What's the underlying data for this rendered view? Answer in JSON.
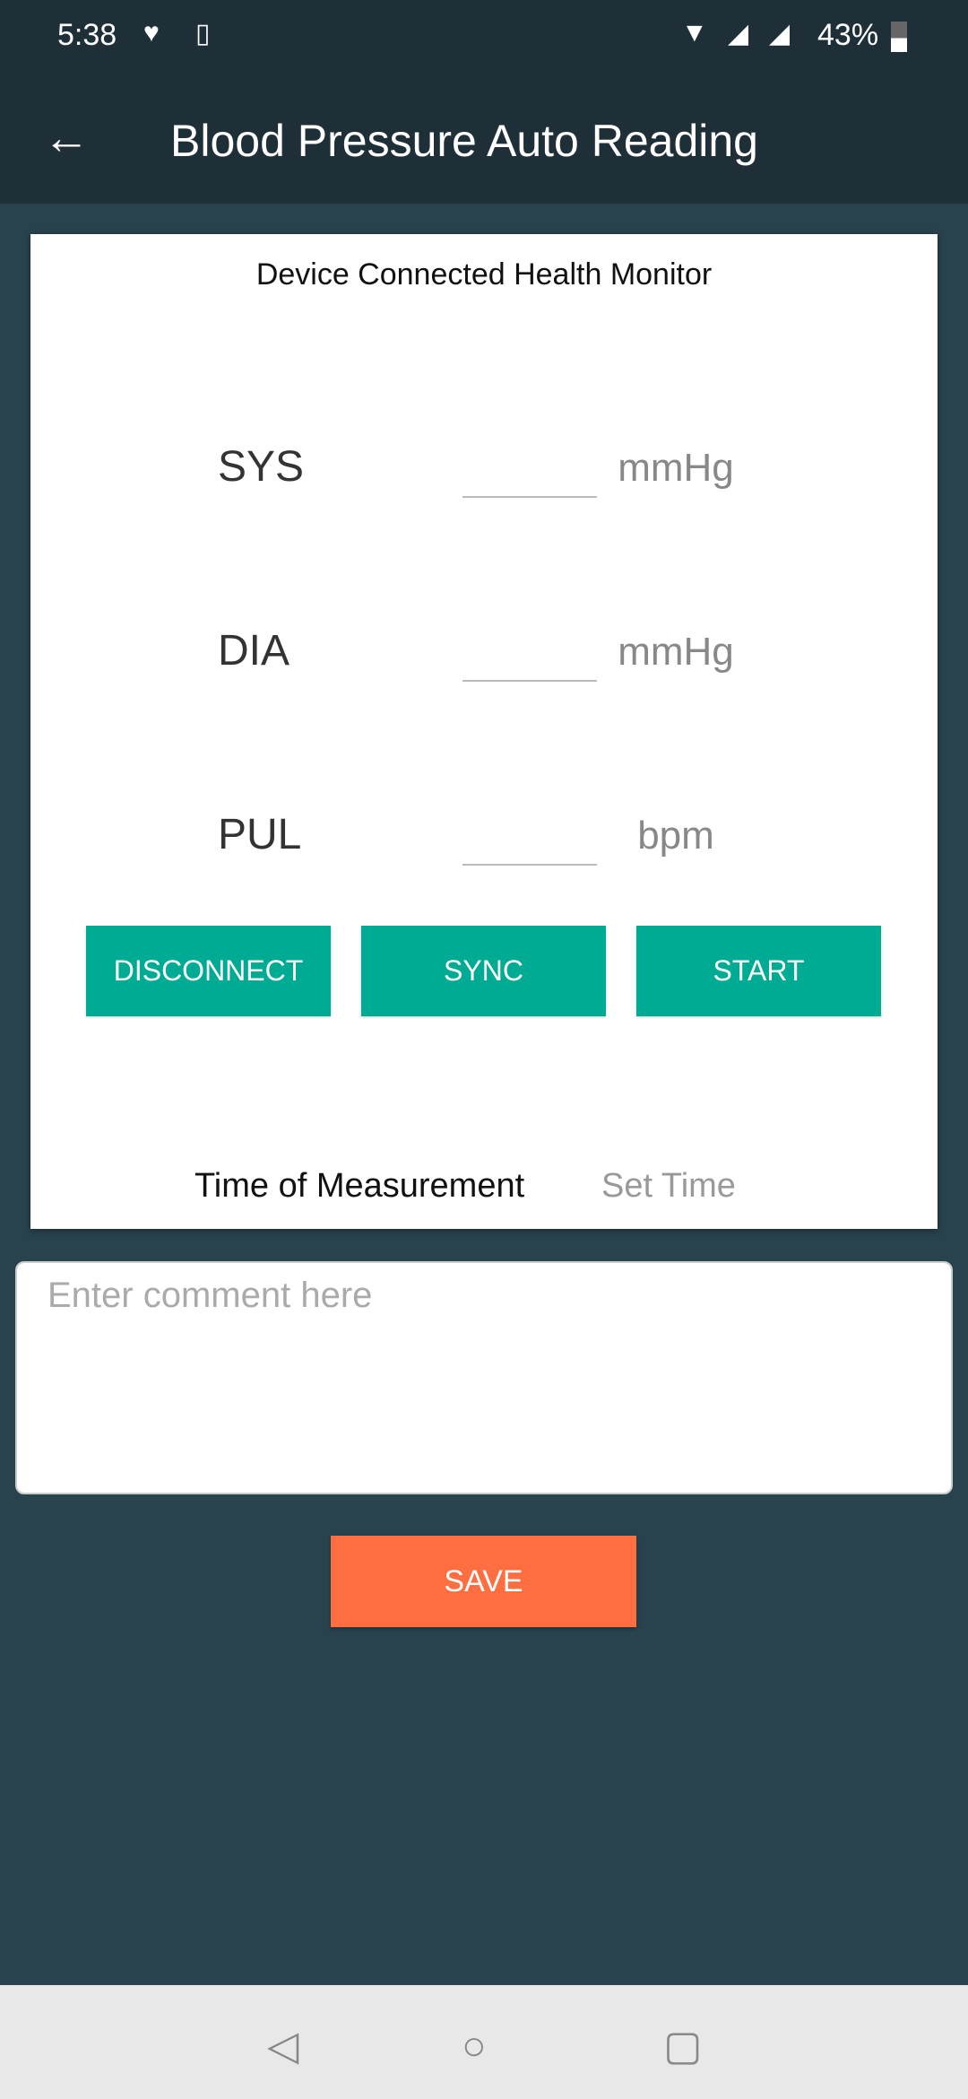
{
  "status_bar": {
    "time": "5:38",
    "battery": "43%",
    "icons": [
      "heart-pulse-icon",
      "speaker-icon",
      "wifi-icon",
      "signal-icon",
      "signal-icon",
      "battery-icon"
    ]
  },
  "app_bar": {
    "title": "Blood Pressure Auto Reading",
    "back_icon": "arrow-left-icon"
  },
  "card": {
    "title": "Device Connected Health Monitor",
    "readings": [
      {
        "label": "SYS",
        "value": "",
        "unit": "mmHg"
      },
      {
        "label": "DIA",
        "value": "",
        "unit": "mmHg"
      },
      {
        "label": "PUL",
        "value": "",
        "unit": "bpm"
      }
    ],
    "buttons": {
      "disconnect": "DISCONNECT",
      "sync": "SYNC",
      "start": "START"
    },
    "time_label": "Time of Measurement",
    "time_value": "Set Time"
  },
  "comment": {
    "placeholder": "Enter comment here",
    "value": ""
  },
  "save_label": "SAVE",
  "colors": {
    "app_bar": "#1f2f38",
    "background": "#29434e",
    "accent": "#00ab94",
    "save": "#ff6e40"
  }
}
